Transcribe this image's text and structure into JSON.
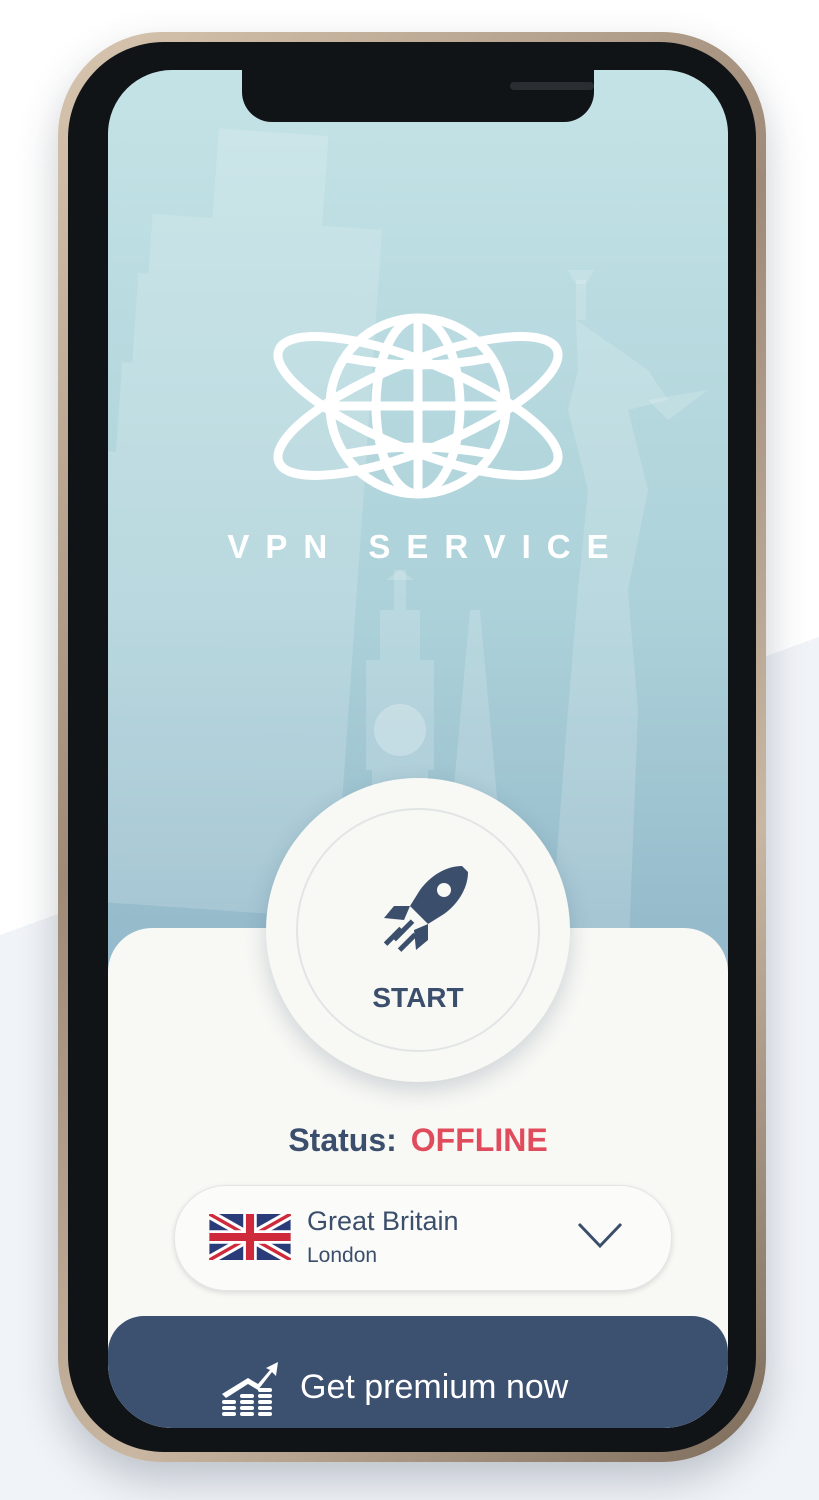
{
  "app": {
    "brand": "VPN SERVICE",
    "start_label": "START"
  },
  "status": {
    "label": "Status:",
    "value": "OFFLINE",
    "value_color": "#e14c5c"
  },
  "location": {
    "country": "Great Britain",
    "city": "London",
    "flag_icon": "uk-flag-icon"
  },
  "premium": {
    "label": "Get premium now",
    "icon": "chart-growth-icon"
  },
  "colors": {
    "accent_dark": "#3c5070",
    "text_primary": "#3b4f6d",
    "sky_top": "#c4e3e6",
    "sky_bottom": "#86abc1"
  }
}
